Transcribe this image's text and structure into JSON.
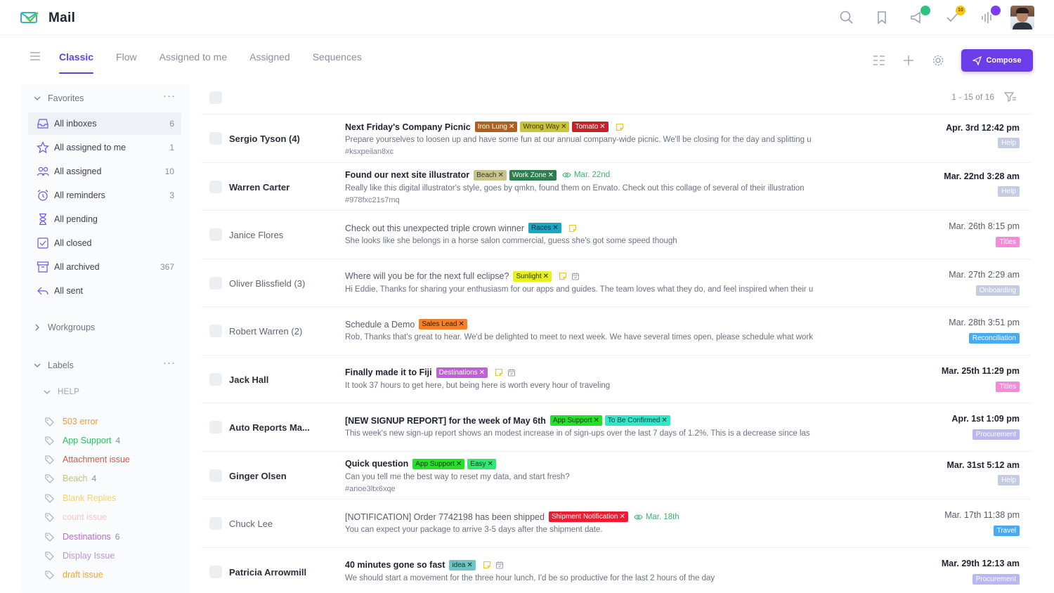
{
  "app": {
    "title": "Mail"
  },
  "header": {
    "notify_badge": "10"
  },
  "tabs": [
    {
      "label": "Classic",
      "active": true
    },
    {
      "label": "Flow",
      "active": false
    },
    {
      "label": "Assigned to me",
      "active": false
    },
    {
      "label": "Assigned",
      "active": false
    },
    {
      "label": "Sequences",
      "active": false
    }
  ],
  "toolbar": {
    "compose_label": "Compose"
  },
  "sidebar": {
    "favorites_label": "Favorites",
    "items": [
      {
        "label": "All inboxes",
        "count": "6",
        "icon": "inbox-icon"
      },
      {
        "label": "All assigned to me",
        "count": "1",
        "icon": "star-icon"
      },
      {
        "label": "All assigned",
        "count": "10",
        "icon": "users-icon"
      },
      {
        "label": "All reminders",
        "count": "3",
        "icon": "alarm-icon"
      },
      {
        "label": "All pending",
        "count": "",
        "icon": "hourglass-icon"
      },
      {
        "label": "All closed",
        "count": "",
        "icon": "closed-check-icon"
      },
      {
        "label": "All archived",
        "count": "367",
        "icon": "archive-icon"
      },
      {
        "label": "All sent",
        "count": "",
        "icon": "sent-icon"
      }
    ],
    "workgroups_label": "Workgroups",
    "labels_label": "Labels",
    "help_label": "HELP",
    "labels": [
      {
        "label": "503 error",
        "count": "",
        "color": "#f59b2b"
      },
      {
        "label": "App Support",
        "count": "4",
        "color": "#22c55e"
      },
      {
        "label": "Attachment issue",
        "count": "",
        "color": "#d9534f"
      },
      {
        "label": "Beach",
        "count": "4",
        "color": "#c4c07a"
      },
      {
        "label": "Blank Replies",
        "count": "",
        "color": "#f2d36b"
      },
      {
        "label": "count issue",
        "count": "",
        "color": "#f4c6c6"
      },
      {
        "label": "Destinations",
        "count": "6",
        "color": "#c166d0"
      },
      {
        "label": "Display Issue",
        "count": "",
        "color": "#b497e0"
      },
      {
        "label": "draft issue",
        "count": "",
        "color": "#f5a623"
      }
    ]
  },
  "list": {
    "pager": "1 - 15 of 16",
    "rows": [
      {
        "sender": "Sergio Tyson (4)",
        "read": false,
        "subject": "Next Friday's Company Picnic",
        "chips": [
          {
            "label": "Iron Lung",
            "bg": "#b0601c",
            "fg": "#ffffff"
          },
          {
            "label": "Wrong Way",
            "bg": "#c9c43a",
            "fg": "#3a3a10"
          },
          {
            "label": "Tomato",
            "bg": "#cc1f2b",
            "fg": "#ffffff"
          }
        ],
        "note": true,
        "cal": false,
        "due": "",
        "preview": "Prepare yourselves to loosen up and have some fun at our annual company-wide picnic. We'll be closing for the day and splitting u",
        "hash": "#ksxpeiian8xc",
        "date": "Apr. 3rd 12:42 pm",
        "badge": "Help",
        "badge_color": "#c5cbe0"
      },
      {
        "sender": "Warren Carter",
        "read": false,
        "subject": "Found our next site illustrator",
        "chips": [
          {
            "label": "Beach",
            "bg": "#c9c48b",
            "fg": "#3a3a20"
          },
          {
            "label": "Work Zone",
            "bg": "#2e7d4f",
            "fg": "#ffffff"
          }
        ],
        "note": false,
        "cal": false,
        "due": "Mar. 22nd",
        "preview": "Really like this digital illustrator's style, goes by qmkn, found them on Envato. Check out this collage of several of their illustration",
        "hash": "#978fxc21s7mq",
        "date": "Mar. 22nd 3:28 am",
        "badge": "Help",
        "badge_color": "#c5cbe0"
      },
      {
        "sender": "Janice Flores",
        "read": true,
        "subject": "Check out this unexpected triple crown winner",
        "chips": [
          {
            "label": "Races",
            "bg": "#1aa7c4",
            "fg": "#0b2a44"
          }
        ],
        "note": true,
        "cal": false,
        "due": "",
        "preview": "She looks like she belongs in a horse salon commercial, guess she's got some speed though",
        "hash": "",
        "date": "Mar. 26th 8:15 pm",
        "badge": "Titles",
        "badge_color": "#f58bd8"
      },
      {
        "sender": "Oliver Blissfield (3)",
        "read": true,
        "subject": "Where will you be for the next full eclipse?",
        "chips": [
          {
            "label": "Sunlight",
            "bg": "#e6f01e",
            "fg": "#2e3000"
          }
        ],
        "note": true,
        "cal": true,
        "due": "",
        "preview": "Hi Eddie, Thanks for sharing your enthusiasm for our apps and guides. The team loves what they do, and feel inspired when their u",
        "hash": "",
        "date": "Mar. 27th 2:29 am",
        "badge": "Onboarding",
        "badge_color": "#c5cbe0"
      },
      {
        "sender": "Robert Warren (2)",
        "read": true,
        "subject": "Schedule a Demo",
        "chips": [
          {
            "label": "Sales Lead",
            "bg": "#f2802b",
            "fg": "#3a1800"
          }
        ],
        "note": false,
        "cal": false,
        "due": "",
        "preview": "Rob, Thanks that's great to hear. We'd be delighted to meet to next week. We have several times open, please schedule what work",
        "hash": "",
        "date": "Mar. 28th 3:51 pm",
        "badge": "Reconciliation",
        "badge_color": "#4aaaf0"
      },
      {
        "sender": "Jack Hall",
        "read": false,
        "subject": "Finally made it to Fiji",
        "chips": [
          {
            "label": "Destinations",
            "bg": "#c05fd6",
            "fg": "#ffffff"
          }
        ],
        "note": true,
        "cal": true,
        "due": "",
        "preview": "It took 37 hours to get here, but being here is worth every hour of traveling",
        "hash": "",
        "date": "Mar. 25th 11:29 pm",
        "badge": "Titles",
        "badge_color": "#f58bd8"
      },
      {
        "sender": "Auto Reports Ma...",
        "read": false,
        "subject": "[NEW SIGNUP REPORT] for the week of May 6th",
        "chips": [
          {
            "label": "App Support",
            "bg": "#27e02a",
            "fg": "#0d3a0d"
          },
          {
            "label": "To Be Confirmed",
            "bg": "#2fe8c8",
            "fg": "#0b3a36"
          }
        ],
        "note": false,
        "cal": false,
        "due": "",
        "preview": "This week's new sign-up report shows an modest increase in of sign-ups over the last 7 days of 1.2%. This is a decrease since las",
        "hash": "",
        "date": "Apr. 1st 1:09 pm",
        "badge": "Procurement",
        "badge_color": "#b9b6f3"
      },
      {
        "sender": "Ginger Olsen",
        "read": false,
        "subject": "Quick question",
        "chips": [
          {
            "label": "App Support",
            "bg": "#27e02a",
            "fg": "#0d3a0d"
          },
          {
            "label": "Easy",
            "bg": "#2fe870",
            "fg": "#0b3a1c"
          }
        ],
        "note": false,
        "cal": false,
        "due": "",
        "preview": "Can you tell me the best way to reset my data, and start fresh?",
        "hash": "#anoe3ltx6xqe",
        "date": "Mar. 31st 5:12 am",
        "badge": "Help",
        "badge_color": "#c5cbe0"
      },
      {
        "sender": "Chuck Lee",
        "read": true,
        "subject": "[NOTIFICATION] Order 7742198 has been shipped",
        "chips": [
          {
            "label": "Shipment Notification",
            "bg": "#ee1c2e",
            "fg": "#ffffff"
          }
        ],
        "note": false,
        "cal": false,
        "due": "Mar. 18th",
        "preview": "You can expect your package to arrive 3-5 days after the shipment date.",
        "hash": "",
        "date": "Mar. 17th 11:38 pm",
        "badge": "Travel",
        "badge_color": "#4aaaf0"
      },
      {
        "sender": "Patricia Arrowmill",
        "read": false,
        "subject": "40 minutes gone so fast",
        "chips": [
          {
            "label": "idea",
            "bg": "#6cc6c6",
            "fg": "#0f3030"
          }
        ],
        "note": true,
        "cal": true,
        "due": "",
        "preview": "We should start a movement for the three hour lunch, I'd be so productive for the last 2 hours of the day",
        "hash": "",
        "date": "Mar. 29th 12:13 am",
        "badge": "Procurement",
        "badge_color": "#b9b6f3"
      }
    ]
  }
}
